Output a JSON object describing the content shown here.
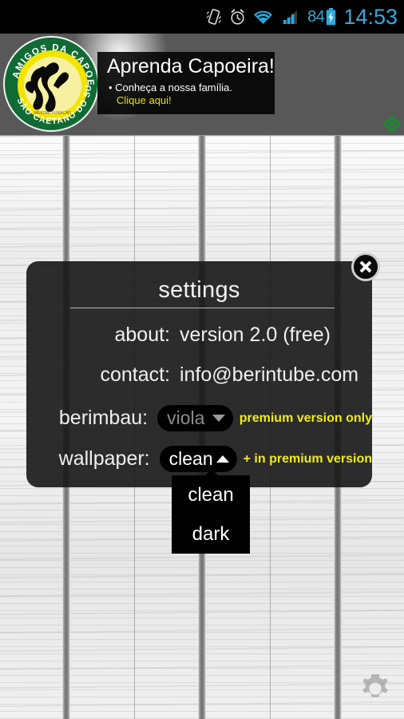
{
  "statusbar": {
    "icons": [
      "vibrate-icon",
      "alarm-clock-icon",
      "wifi-icon",
      "signal-bars-icon"
    ],
    "battery_level": "84",
    "battery_icon": "battery-charging-icon",
    "clock": "14:53",
    "accent_color": "#33a9dd",
    "background_color": "#000000"
  },
  "ad_banner": {
    "name": "capoeira-advertisement",
    "logo_text_top": "AMIGOS DA CAPOEIRA",
    "logo_text_bottom": "SÃO CAETANO DO SUL",
    "headline": "Aprenda Capoeira!",
    "subtext": "• Conheça a nossa família.",
    "cta": "Clique aqui!",
    "cta_color": "#e9e000",
    "adchoices_icon": "green-diamond-adchoices-icon",
    "adchoices_color": "#1a8a2e"
  },
  "background": {
    "name": "berimbau-wood-wallpaper",
    "type": "light-wood-with-strings"
  },
  "dialog": {
    "title": "settings",
    "close_icon": "close-x-icon",
    "rows": [
      {
        "label": "about:",
        "value": "version 2.0 (free)"
      },
      {
        "label": "contact:",
        "value": "info@berintube.com"
      }
    ],
    "berimbau": {
      "label": "berimbau:",
      "selected": "viola",
      "caret_icon": "chevron-down-icon",
      "note": "premium version only",
      "note_color": "#f1ec17",
      "disabled": true
    },
    "wallpaper": {
      "label": "wallpaper:",
      "selected": "clean",
      "caret_icon": "chevron-up-icon",
      "note": "+ in premium version",
      "note_color": "#f1ec17",
      "open": true,
      "options": [
        "clean",
        "dark"
      ]
    }
  },
  "gear_button": {
    "icon": "gear-icon",
    "label": "settings"
  }
}
